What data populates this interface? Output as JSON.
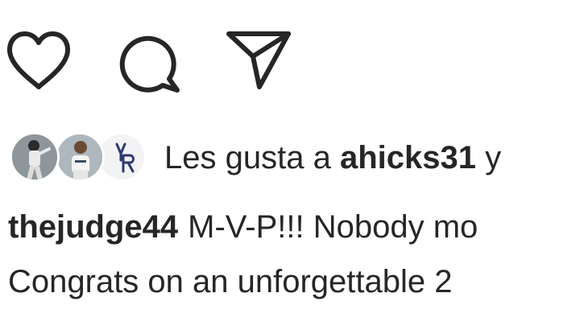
{
  "actions": {
    "like_icon": "heart-outline-icon",
    "comment_icon": "comment-bubble-icon",
    "share_icon": "paper-plane-icon"
  },
  "likes": {
    "prefix": "Les gusta a",
    "username": "ahicks31",
    "suffix": "y"
  },
  "caption": {
    "username": "thejudge44",
    "line1_text": "M-V-P!!! Nobody mo",
    "line2_text": "Congrats on an unforgettable 2"
  },
  "colors": {
    "text": "#262626",
    "background": "#ffffff"
  }
}
